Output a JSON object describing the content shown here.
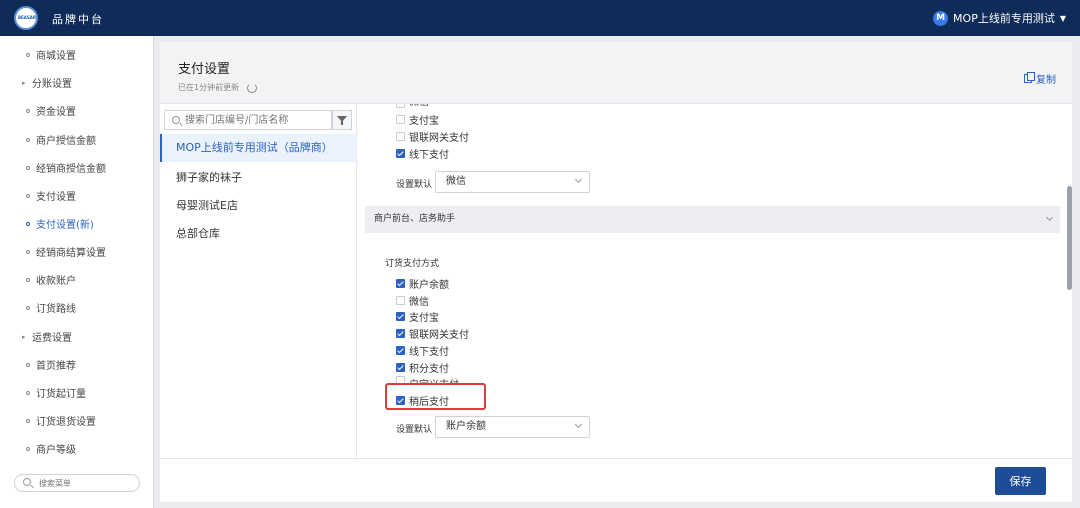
{
  "header": {
    "logo_text": "BEASAR",
    "title": "品牌中台",
    "user_initial": "M",
    "user_name": "MOP上线前专用测试"
  },
  "sidebar": {
    "items": [
      {
        "label": "商城设置",
        "expandable": false
      },
      {
        "label": "分账设置",
        "expandable": true
      },
      {
        "label": "资金设置",
        "expandable": false
      },
      {
        "label": "商户授信金额",
        "expandable": false
      },
      {
        "label": "经销商授信金额",
        "expandable": false
      },
      {
        "label": "支付设置",
        "expandable": false
      },
      {
        "label": "支付设置(新)",
        "expandable": false,
        "active": true
      },
      {
        "label": "经销商结算设置",
        "expandable": false
      },
      {
        "label": "收款账户",
        "expandable": false
      },
      {
        "label": "订货路线",
        "expandable": false
      },
      {
        "label": "运费设置",
        "expandable": true
      },
      {
        "label": "首页推荐",
        "expandable": false
      },
      {
        "label": "订货起订量",
        "expandable": false
      },
      {
        "label": "订货退货设置",
        "expandable": false
      },
      {
        "label": "商户等级",
        "expandable": false
      }
    ],
    "search_placeholder": "搜索菜单"
  },
  "page": {
    "title": "支付设置",
    "updated": "已在1分钟前更新",
    "copy_label": "复制"
  },
  "stores": {
    "search_placeholder": "搜索门店编号/门店名称",
    "items": [
      {
        "label": "MOP上线前专用测试（品牌商）",
        "active": true
      },
      {
        "label": "狮子家的袜子"
      },
      {
        "label": "母婴测试E店"
      },
      {
        "label": "总部仓库"
      }
    ]
  },
  "settings": {
    "top_group": {
      "options": [
        {
          "label": "微信",
          "checked": false
        },
        {
          "label": "支付宝",
          "checked": false
        },
        {
          "label": "银联网关支付",
          "checked": false
        },
        {
          "label": "线下支付",
          "checked": true
        }
      ],
      "default_label": "设置默认",
      "default_value": "微信"
    },
    "section_title": "商户前台、店务助手",
    "order_group": {
      "title": "订货支付方式",
      "options": [
        {
          "label": "账户余额",
          "checked": true
        },
        {
          "label": "微信",
          "checked": false
        },
        {
          "label": "支付宝",
          "checked": true
        },
        {
          "label": "银联网关支付",
          "checked": true
        },
        {
          "label": "线下支付",
          "checked": true
        },
        {
          "label": "积分支付",
          "checked": true
        },
        {
          "label": "自定义支付",
          "checked": false
        },
        {
          "label": "稍后支付",
          "checked": true
        }
      ],
      "default_label": "设置默认",
      "default_value": "账户余额"
    }
  },
  "footer": {
    "save_label": "保存"
  },
  "colors": {
    "topbar": "#0f2c59",
    "accent": "#2b62c4",
    "save_button": "#1f4c96",
    "highlight": "#e03a3a"
  }
}
